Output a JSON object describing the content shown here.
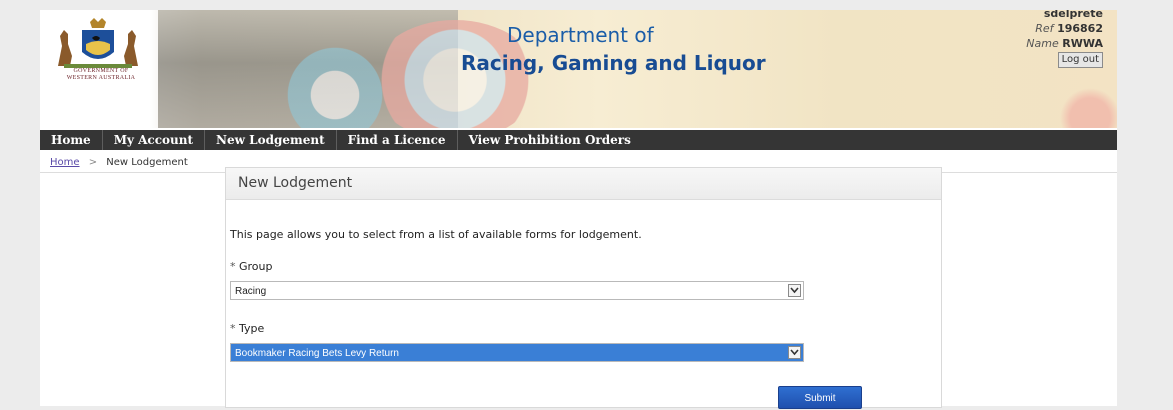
{
  "header": {
    "logo_text_line1": "GOVERNMENT OF",
    "logo_text_line2": "WESTERN AUSTRALIA",
    "dept_line1": "Department of",
    "dept_line2": "Racing, Gaming and Liquor"
  },
  "user": {
    "username": "sdelprete",
    "ref_label": "Ref",
    "ref_value": "196862",
    "name_label": "Name",
    "name_value": "RWWA",
    "logout_label": "Log out"
  },
  "nav": {
    "items": [
      {
        "label": "Home"
      },
      {
        "label": "My Account"
      },
      {
        "label": "New Lodgement"
      },
      {
        "label": "Find a Licence"
      },
      {
        "label": "View Prohibition Orders"
      }
    ]
  },
  "breadcrumb": {
    "home": "Home",
    "separator": ">",
    "current": "New Lodgement"
  },
  "panel": {
    "title": "New Lodgement",
    "intro": "This page allows you to select from a list of available forms for lodgement.",
    "group_label": "Group",
    "group_value": "Racing",
    "type_label": "Type",
    "type_value": "Bookmaker Racing Bets Levy Return",
    "required_marker": "*",
    "submit_label": "Submit"
  },
  "icons": {
    "logo": "wa-coat-of-arms-icon",
    "dropdown": "chevron-down-icon"
  },
  "colors": {
    "nav_bg": "#353535",
    "dept_blue": "#184c93",
    "selected_bg": "#3a7fd6",
    "button_blue": "#1f50ae"
  }
}
